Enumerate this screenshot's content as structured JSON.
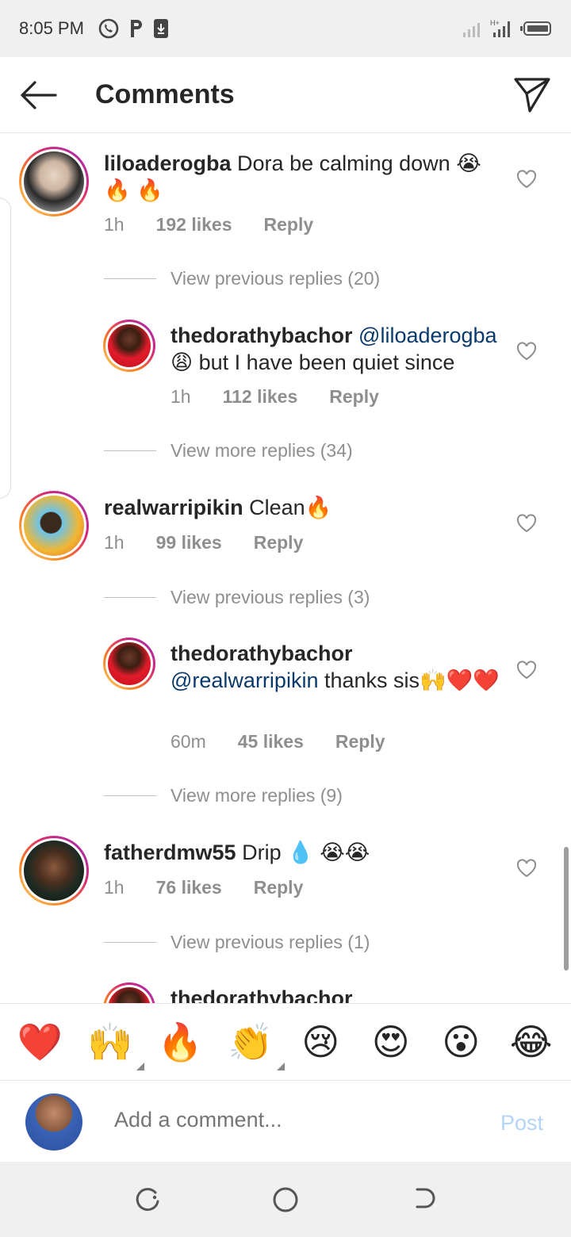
{
  "status_bar": {
    "time": "8:05 PM"
  },
  "header": {
    "title": "Comments"
  },
  "comments": [
    {
      "username": "liloaderogba",
      "text": "Dora be calming down 😭🔥 🔥",
      "time": "1h",
      "likes": "192 likes",
      "reply": "Reply",
      "view_replies": "View previous replies (20)"
    },
    {
      "username": "thedorathybachor",
      "mention": "@liloaderogba",
      "text": "😩 but I have been quiet since",
      "time": "1h",
      "likes": "112 likes",
      "reply": "Reply",
      "view_replies": "View more replies (34)"
    },
    {
      "username": "realwarripikin",
      "text": "Clean🔥",
      "time": "1h",
      "likes": "99 likes",
      "reply": "Reply",
      "view_replies": "View previous replies (3)"
    },
    {
      "username": "thedorathybachor",
      "mention": "@realwarripikin",
      "text": "thanks sis🙌❤️❤️",
      "time": "60m",
      "likes": "45 likes",
      "reply": "Reply",
      "view_replies": "View more replies (9)"
    },
    {
      "username": "fatherdmw55",
      "text": "Drip 💧 😭😭",
      "time": "1h",
      "likes": "76 likes",
      "reply": "Reply",
      "view_replies": "View previous replies (1)"
    },
    {
      "username": "thedorathybachor"
    }
  ],
  "reactions": [
    "❤️",
    "🙌",
    "🔥",
    "👏",
    "😢",
    "😍",
    "😮",
    "😂"
  ],
  "composer": {
    "placeholder": "Add a comment...",
    "post_label": "Post"
  },
  "colors": {
    "mention": "#0a3a6b",
    "muted": "#8e8e8e",
    "post_disabled": "#b3d4f5"
  }
}
